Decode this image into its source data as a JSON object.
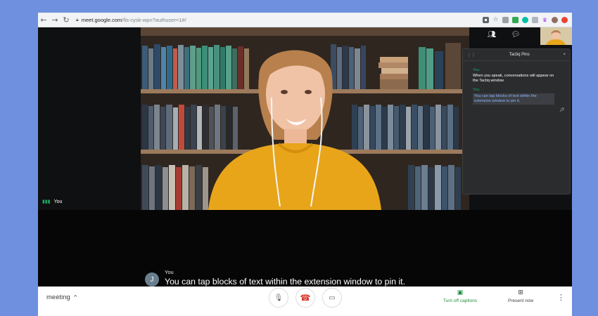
{
  "browser": {
    "back_icon": "back-arrow-icon",
    "url_domain": "meet.google.com",
    "url_path": "/fis-cysk-wpn?authuser=1#/"
  },
  "meet": {
    "self_label": "You",
    "tactiq": {
      "title": "Tactiq Pins",
      "close": "×",
      "entries": [
        {
          "speaker": "You",
          "text": "When you speak, conversations will appear on the Tactiq window"
        },
        {
          "speaker": "You",
          "text": "You can tap blocks of text within the extension window to pin it."
        }
      ]
    },
    "caption": {
      "avatar_letter": "J",
      "speaker": "You",
      "text": "You can tap blocks of text within the extension window to pin it."
    }
  },
  "bottom_bar": {
    "meeting_label": "meeting",
    "captions_label": "Turn off captions",
    "present_label": "Present now"
  },
  "colors": {
    "accent_green": "#1ea362",
    "end_call_red": "#d93025",
    "page_bg": "#6f8fdf"
  }
}
